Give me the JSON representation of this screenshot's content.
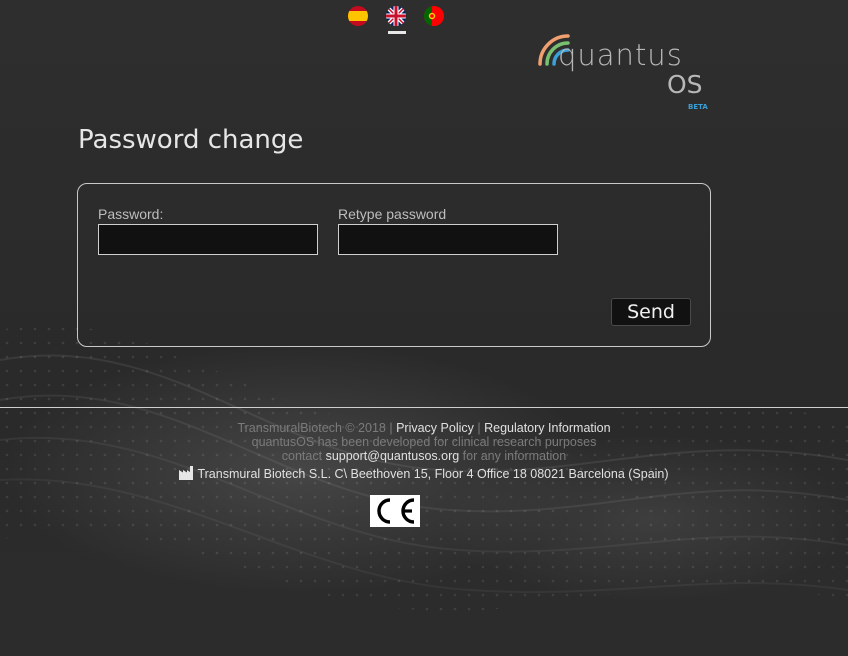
{
  "languages": [
    {
      "code": "es",
      "name": "Spanish",
      "icon": "spain-flag-icon"
    },
    {
      "code": "en",
      "name": "English",
      "icon": "uk-flag-icon",
      "selected": true
    },
    {
      "code": "pt",
      "name": "Portuguese",
      "icon": "portugal-flag-icon"
    }
  ],
  "logo": {
    "brand": "quantus",
    "sub": "OS",
    "badge": "BETA",
    "colors": {
      "arc_orange": "#f0a070",
      "arc_green": "#78c070",
      "arc_blue": "#3aa0d8"
    }
  },
  "page": {
    "title": "Password change"
  },
  "form": {
    "password_label": "Password:",
    "password_value": "",
    "retype_label": "Retype password",
    "retype_value": "",
    "send_label": "Send"
  },
  "footer": {
    "company": "TransmuralBiotech © 2018",
    "separator": "|",
    "privacy_link": "Privacy Policy",
    "regulatory_link": "Regulatory Information",
    "dev_note": "quantusOS has been developed for clinical research purposes",
    "contact_prefix": "contact",
    "contact_email": "support@quantusos.org",
    "contact_suffix": "for any information",
    "address": "Transmural Biotech S.L. C\\ Beethoven 15, Floor 4 Office 18 08021 Barcelona (Spain)",
    "ce_label": "CE"
  }
}
